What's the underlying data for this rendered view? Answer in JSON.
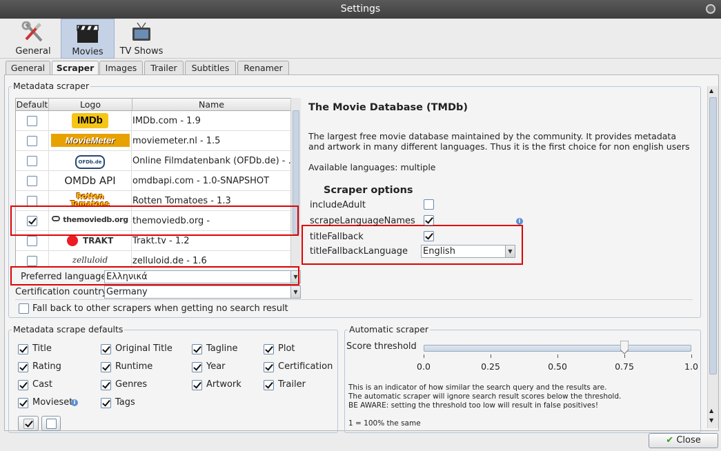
{
  "window": {
    "title": "Settings"
  },
  "top_tabs": [
    {
      "label": "General",
      "icon": "tools-icon"
    },
    {
      "label": "Movies",
      "icon": "clapperboard-icon"
    },
    {
      "label": "TV Shows",
      "icon": "tv-icon"
    }
  ],
  "sub_tabs": [
    "General",
    "Scraper",
    "Images",
    "Trailer",
    "Subtitles",
    "Renamer"
  ],
  "metadata_scraper": {
    "title": "Metadata scraper",
    "columns": [
      "Default",
      "Logo",
      "Name"
    ],
    "rows": [
      {
        "logo": "IMDb",
        "name": "IMDb.com - 1.9",
        "checked": false
      },
      {
        "logo": "MovieMeter",
        "name": "moviemeter.nl - 1.5",
        "checked": false
      },
      {
        "logo": "OFDb.de",
        "name": "Online Filmdatenbank (OFDb.de) - ...",
        "checked": false
      },
      {
        "logo": "OMDb API",
        "name": "omdbapi.com - 1.0-SNAPSHOT",
        "checked": false
      },
      {
        "logo": "Rotten Tomatoes",
        "name": "Rotten Tomatoes - 1.3",
        "checked": false
      },
      {
        "logo": "themoviedb.org",
        "name": "themoviedb.org -",
        "checked": true
      },
      {
        "logo": "TRAKT",
        "name": "Trakt.tv - 1.2",
        "checked": false
      },
      {
        "logo": "zelluloid",
        "name": "zelluloid.de - 1.6",
        "checked": false
      }
    ],
    "preferred_language_label": "Preferred language",
    "preferred_language_value": "Ελληνικά",
    "certification_label": "Certification country",
    "certification_value": "Germany",
    "fallback_label": "Fall back to other scrapers when getting no search result"
  },
  "details": {
    "title": "The Movie Database (TMDb)",
    "description": "The largest free movie database maintained by the community. It provides metadata and artwork in many different languages. Thus it is the first choice for non english users",
    "languages": "Available languages: multiple",
    "options_title": "Scraper options",
    "options": [
      {
        "label": "includeAdult",
        "checked": false
      },
      {
        "label": "scrapeLanguageNames",
        "checked": true
      },
      {
        "label": "titleFallback",
        "checked": true
      }
    ],
    "fallback_language_label": "titleFallbackLanguage",
    "fallback_language_value": "English"
  },
  "defaults": {
    "title": "Metadata scrape defaults",
    "items": [
      {
        "label": "Title",
        "checked": true
      },
      {
        "label": "Original Title",
        "checked": true
      },
      {
        "label": "Tagline",
        "checked": true
      },
      {
        "label": "Plot",
        "checked": true
      },
      {
        "label": "Rating",
        "checked": true
      },
      {
        "label": "Runtime",
        "checked": true
      },
      {
        "label": "Year",
        "checked": true
      },
      {
        "label": "Certification",
        "checked": true
      },
      {
        "label": "Cast",
        "checked": true
      },
      {
        "label": "Genres",
        "checked": true
      },
      {
        "label": "Artwork",
        "checked": true
      },
      {
        "label": "Trailer",
        "checked": true
      },
      {
        "label": "Movieset",
        "checked": true
      },
      {
        "label": "Tags",
        "checked": true
      }
    ]
  },
  "auto_scraper": {
    "title": "Automatic scraper",
    "threshold_label": "Score threshold",
    "threshold_value": 0.75,
    "ticks": [
      "0.0",
      "0.25",
      "0.50",
      "0.75",
      "1.0"
    ],
    "info": [
      "This is an indicator of how similar the search query and the results are.",
      "The automatic scraper will ignore search result scores below the threshold.",
      "BE AWARE: setting the threshold too low will result in false positives!",
      "",
      "1 = 100% the same"
    ]
  },
  "buttons": {
    "close": "Close"
  }
}
